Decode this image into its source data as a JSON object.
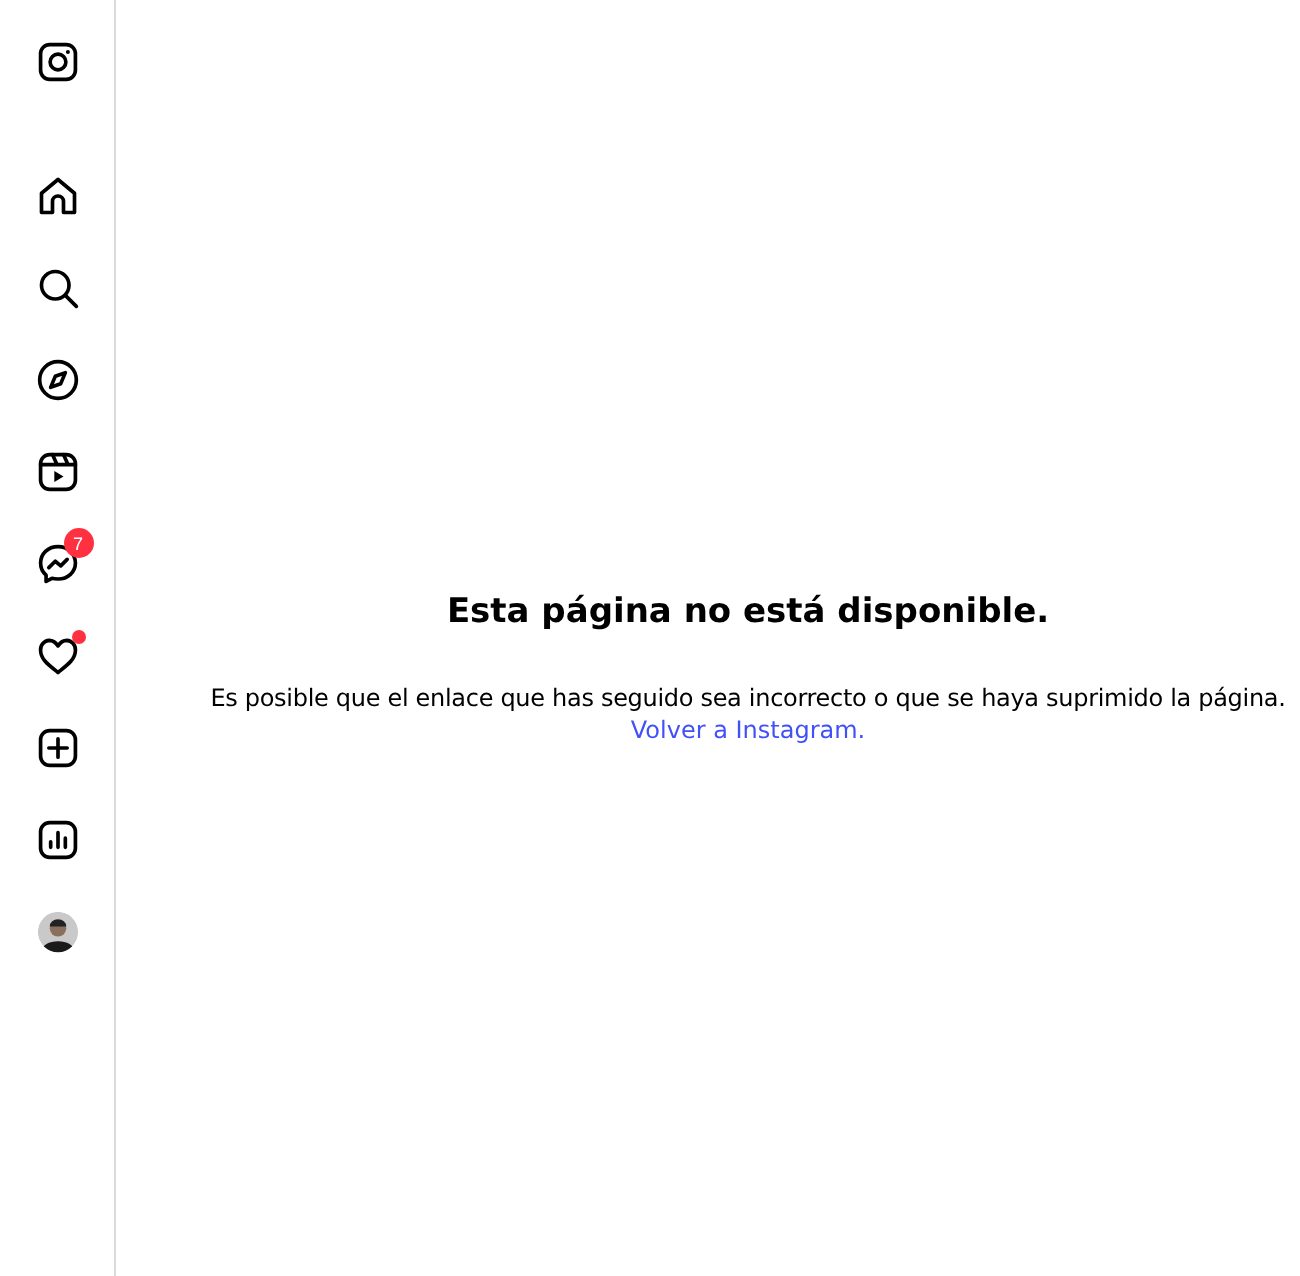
{
  "sidebar": {
    "items": [
      {
        "kind": "logo"
      },
      {
        "kind": "home"
      },
      {
        "kind": "search"
      },
      {
        "kind": "explore"
      },
      {
        "kind": "reels"
      },
      {
        "kind": "messages",
        "badge": "7"
      },
      {
        "kind": "notifications",
        "has_dot": true
      },
      {
        "kind": "create"
      },
      {
        "kind": "dashboard"
      },
      {
        "kind": "profile"
      }
    ]
  },
  "main": {
    "title": "Esta página no está disponible.",
    "message": "Es posible que el enlace que has seguido sea incorrecto o que se haya suprimido la página.",
    "link": "Volver a Instagram."
  }
}
